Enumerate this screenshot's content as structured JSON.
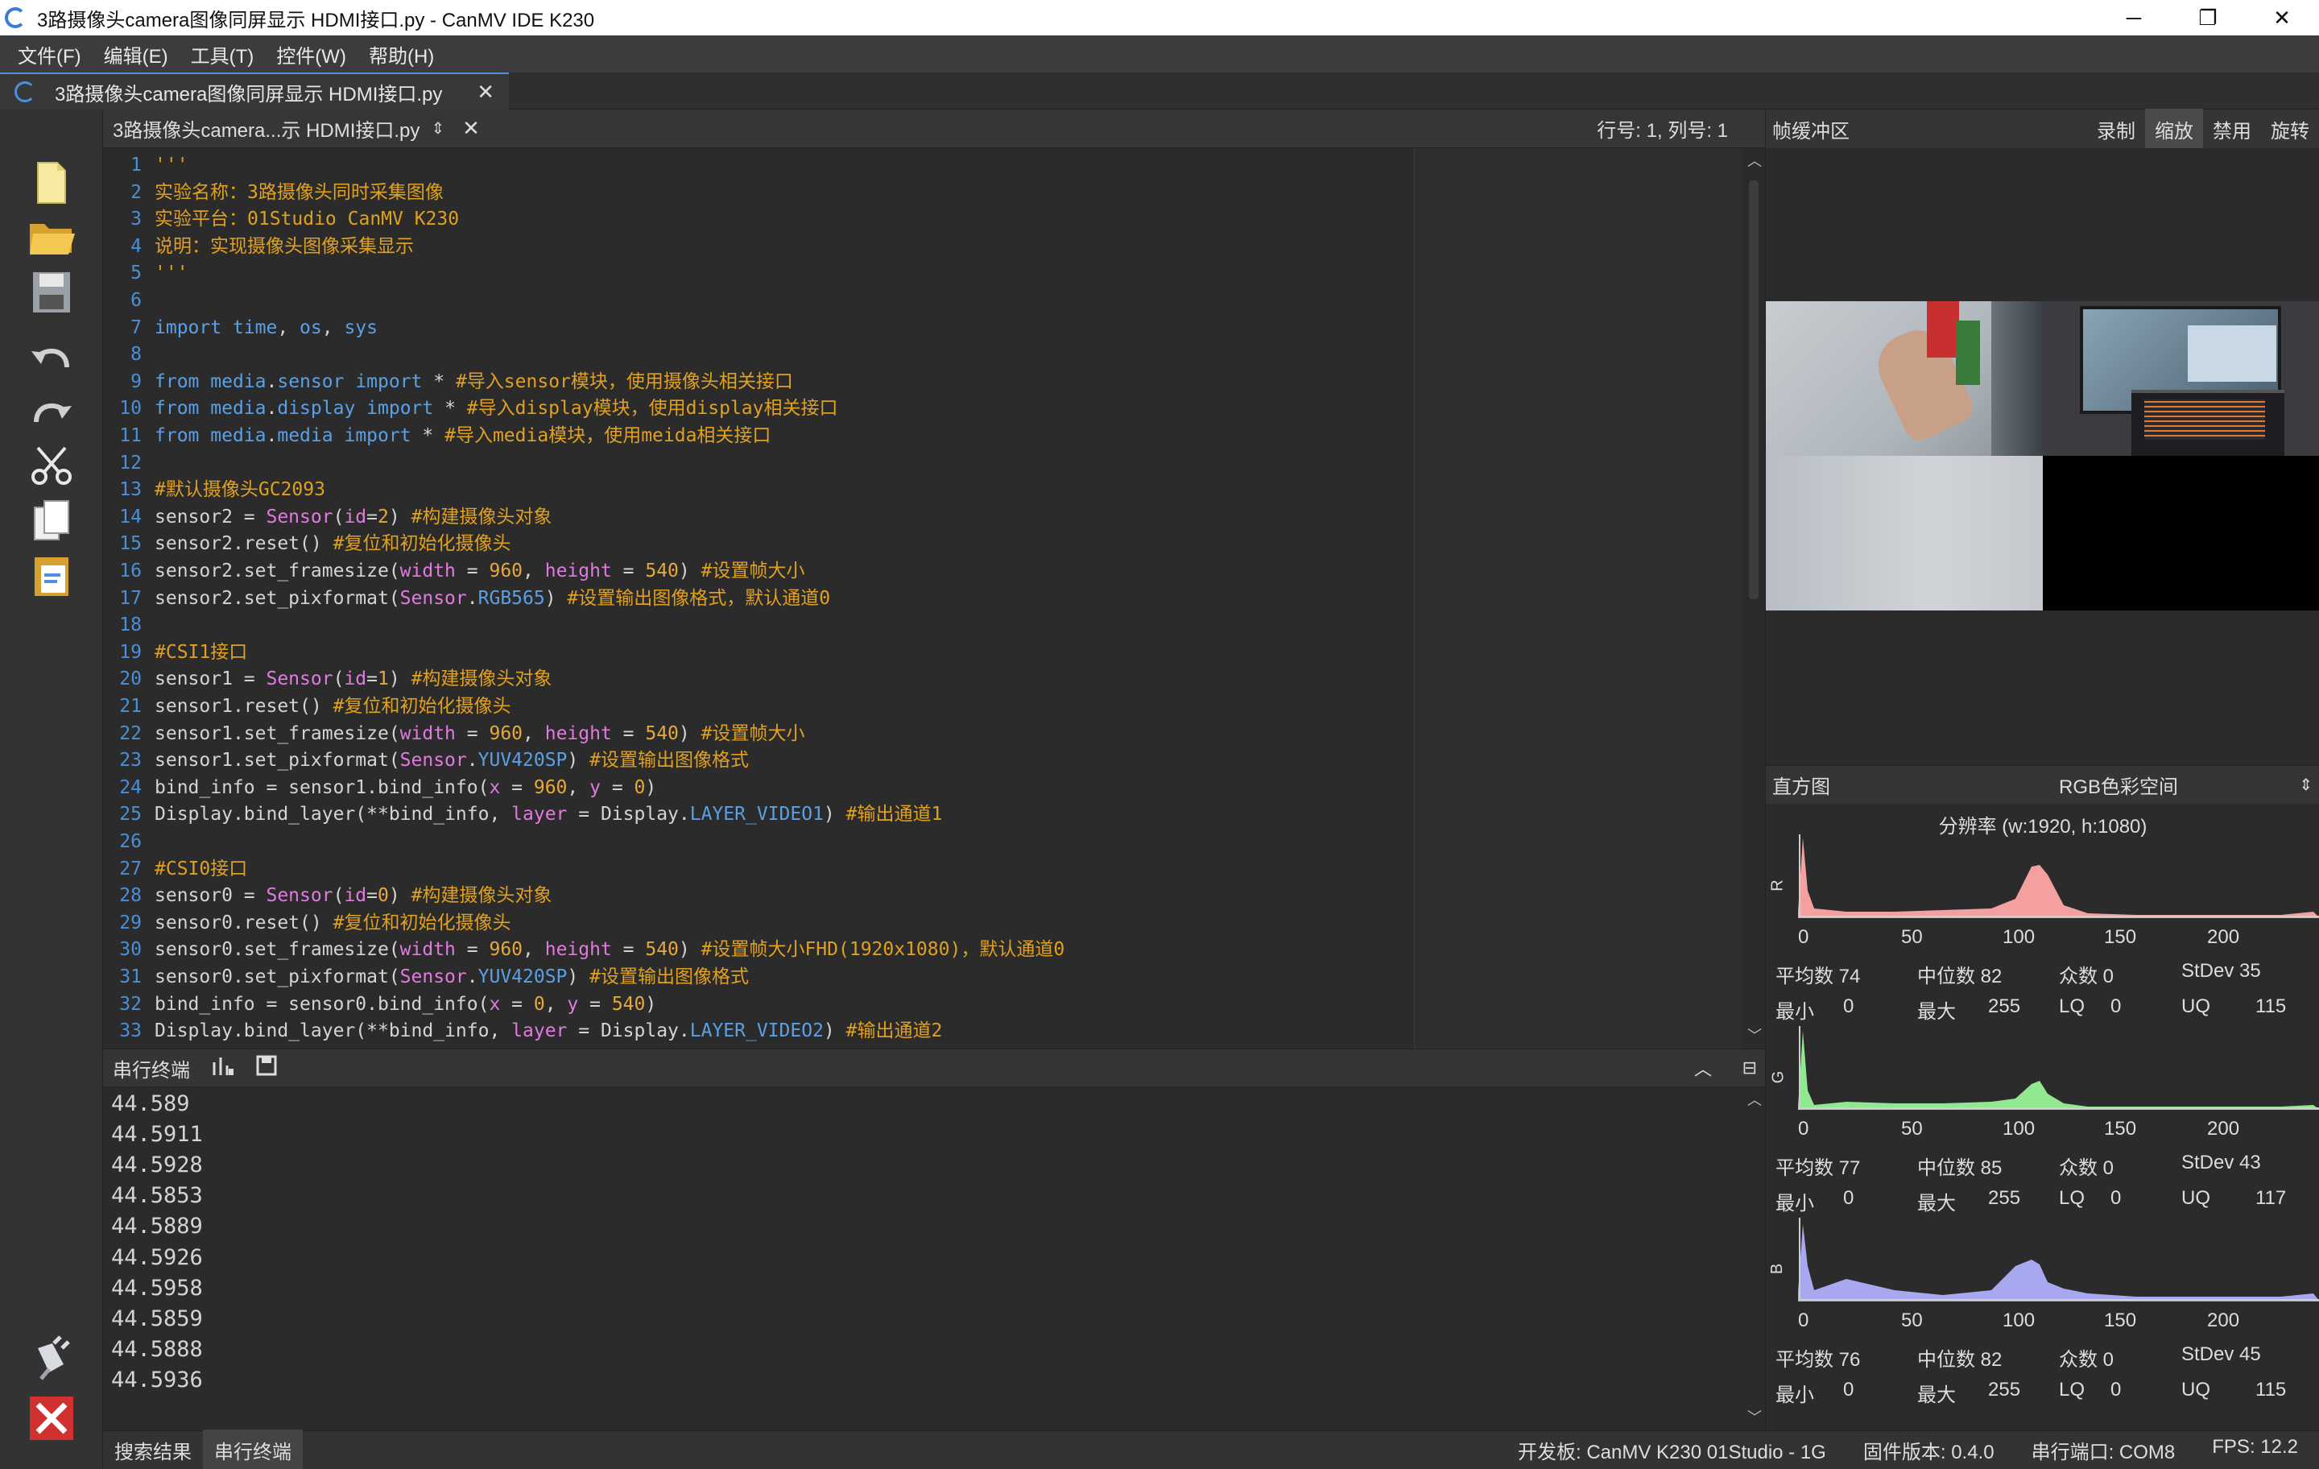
{
  "window": {
    "title": "3路摄像头camera图像同屏显示 HDMI接口.py - CanMV IDE K230",
    "controls": [
      "─",
      "❐",
      "✕"
    ]
  },
  "menu": [
    "文件(F)",
    "编辑(E)",
    "工具(T)",
    "控件(W)",
    "帮助(H)"
  ],
  "file_tab": {
    "name": "3路摄像头camera图像同屏显示 HDMI接口.py",
    "close": "✕"
  },
  "editor": {
    "filename": "3路摄像头camera...示 HDMI接口.py",
    "sort_icon": "⇕",
    "close": "✕",
    "cursor_pos": "行号: 1, 列号: 1",
    "lines": [
      "'''",
      "实验名称：3路摄像头同时采集图像",
      "实验平台：01Studio CanMV K230",
      "说明：实现摄像头图像采集显示",
      "'''",
      "",
      "import time, os, sys",
      "",
      "from media.sensor import * #导入sensor模块，使用摄像头相关接口",
      "from media.display import * #导入display模块，使用display相关接口",
      "from media.media import * #导入media模块，使用meida相关接口",
      "",
      "#默认摄像头GC2093",
      "sensor2 = Sensor(id=2) #构建摄像头对象",
      "sensor2.reset() #复位和初始化摄像头",
      "sensor2.set_framesize(width = 960, height = 540) #设置帧大小",
      "sensor2.set_pixformat(Sensor.RGB565) #设置输出图像格式，默认通道0",
      "",
      "#CSI1接口",
      "sensor1 = Sensor(id=1) #构建摄像头对象",
      "sensor1.reset() #复位和初始化摄像头",
      "sensor1.set_framesize(width = 960, height = 540) #设置帧大小",
      "sensor1.set_pixformat(Sensor.YUV420SP) #设置输出图像格式",
      "bind_info = sensor1.bind_info(x = 960, y = 0)",
      "Display.bind_layer(**bind_info, layer = Display.LAYER_VIDEO1) #输出通道1",
      "",
      "#CSI0接口",
      "sensor0 = Sensor(id=0) #构建摄像头对象",
      "sensor0.reset() #复位和初始化摄像头",
      "sensor0.set_framesize(width = 960, height = 540) #设置帧大小FHD(1920x1080)，默认通道0",
      "sensor0.set_pixformat(Sensor.YUV420SP) #设置输出图像格式",
      "bind_info = sensor0.bind_info(x = 0, y = 540)",
      "Display.bind_layer(**bind_info, layer = Display.LAYER_VIDEO2) #输出通道2"
    ]
  },
  "terminal": {
    "title": "串行终端",
    "lines": [
      "44.589",
      "44.5911",
      "44.5928",
      "44.5853",
      "44.5889",
      "44.5926",
      "44.5958",
      "44.5859",
      "44.5888",
      "44.5936"
    ]
  },
  "status": {
    "tabs": [
      "搜索结果",
      "串行终端"
    ],
    "board": "开发板: CanMV K230 01Studio - 1G",
    "firmware": "固件版本: 0.4.0",
    "port": "串行端口: COM8",
    "fps": "FPS:   12.2"
  },
  "framebuffer": {
    "title": "帧缓冲区",
    "buttons": [
      "录制",
      "缩放",
      "禁用",
      "旋转"
    ]
  },
  "histogram": {
    "title": "直方图",
    "colorspace": "RGB色彩空间",
    "arrows": "⇕",
    "resolution": "分辨率 (w:1920, h:1080)",
    "ticks": [
      "0",
      "50",
      "100",
      "150",
      "200"
    ],
    "channels": [
      {
        "label": "R",
        "color": "#f4a0a0",
        "mean": "平均数 74",
        "median": "中位数 82",
        "mode": "众数 0",
        "stdev": "StDev 35",
        "min": "最小",
        "min_v": "0",
        "max": "最大",
        "max_v": "255",
        "lq": "LQ",
        "lq_v": "0",
        "uq": "UQ",
        "uq_v": "115"
      },
      {
        "label": "G",
        "color": "#90e890",
        "mean": "平均数 77",
        "median": "中位数 85",
        "mode": "众数 0",
        "stdev": "StDev 43",
        "min": "最小",
        "min_v": "0",
        "max": "最大",
        "max_v": "255",
        "lq": "LQ",
        "lq_v": "0",
        "uq": "UQ",
        "uq_v": "117"
      },
      {
        "label": "B",
        "color": "#a8a8f0",
        "mean": "平均数 76",
        "median": "中位数 82",
        "mode": "众数 0",
        "stdev": "StDev 45",
        "min": "最小",
        "min_v": "0",
        "max": "最大",
        "max_v": "255",
        "lq": "LQ",
        "lq_v": "0",
        "uq": "UQ",
        "uq_v": "115"
      }
    ]
  }
}
